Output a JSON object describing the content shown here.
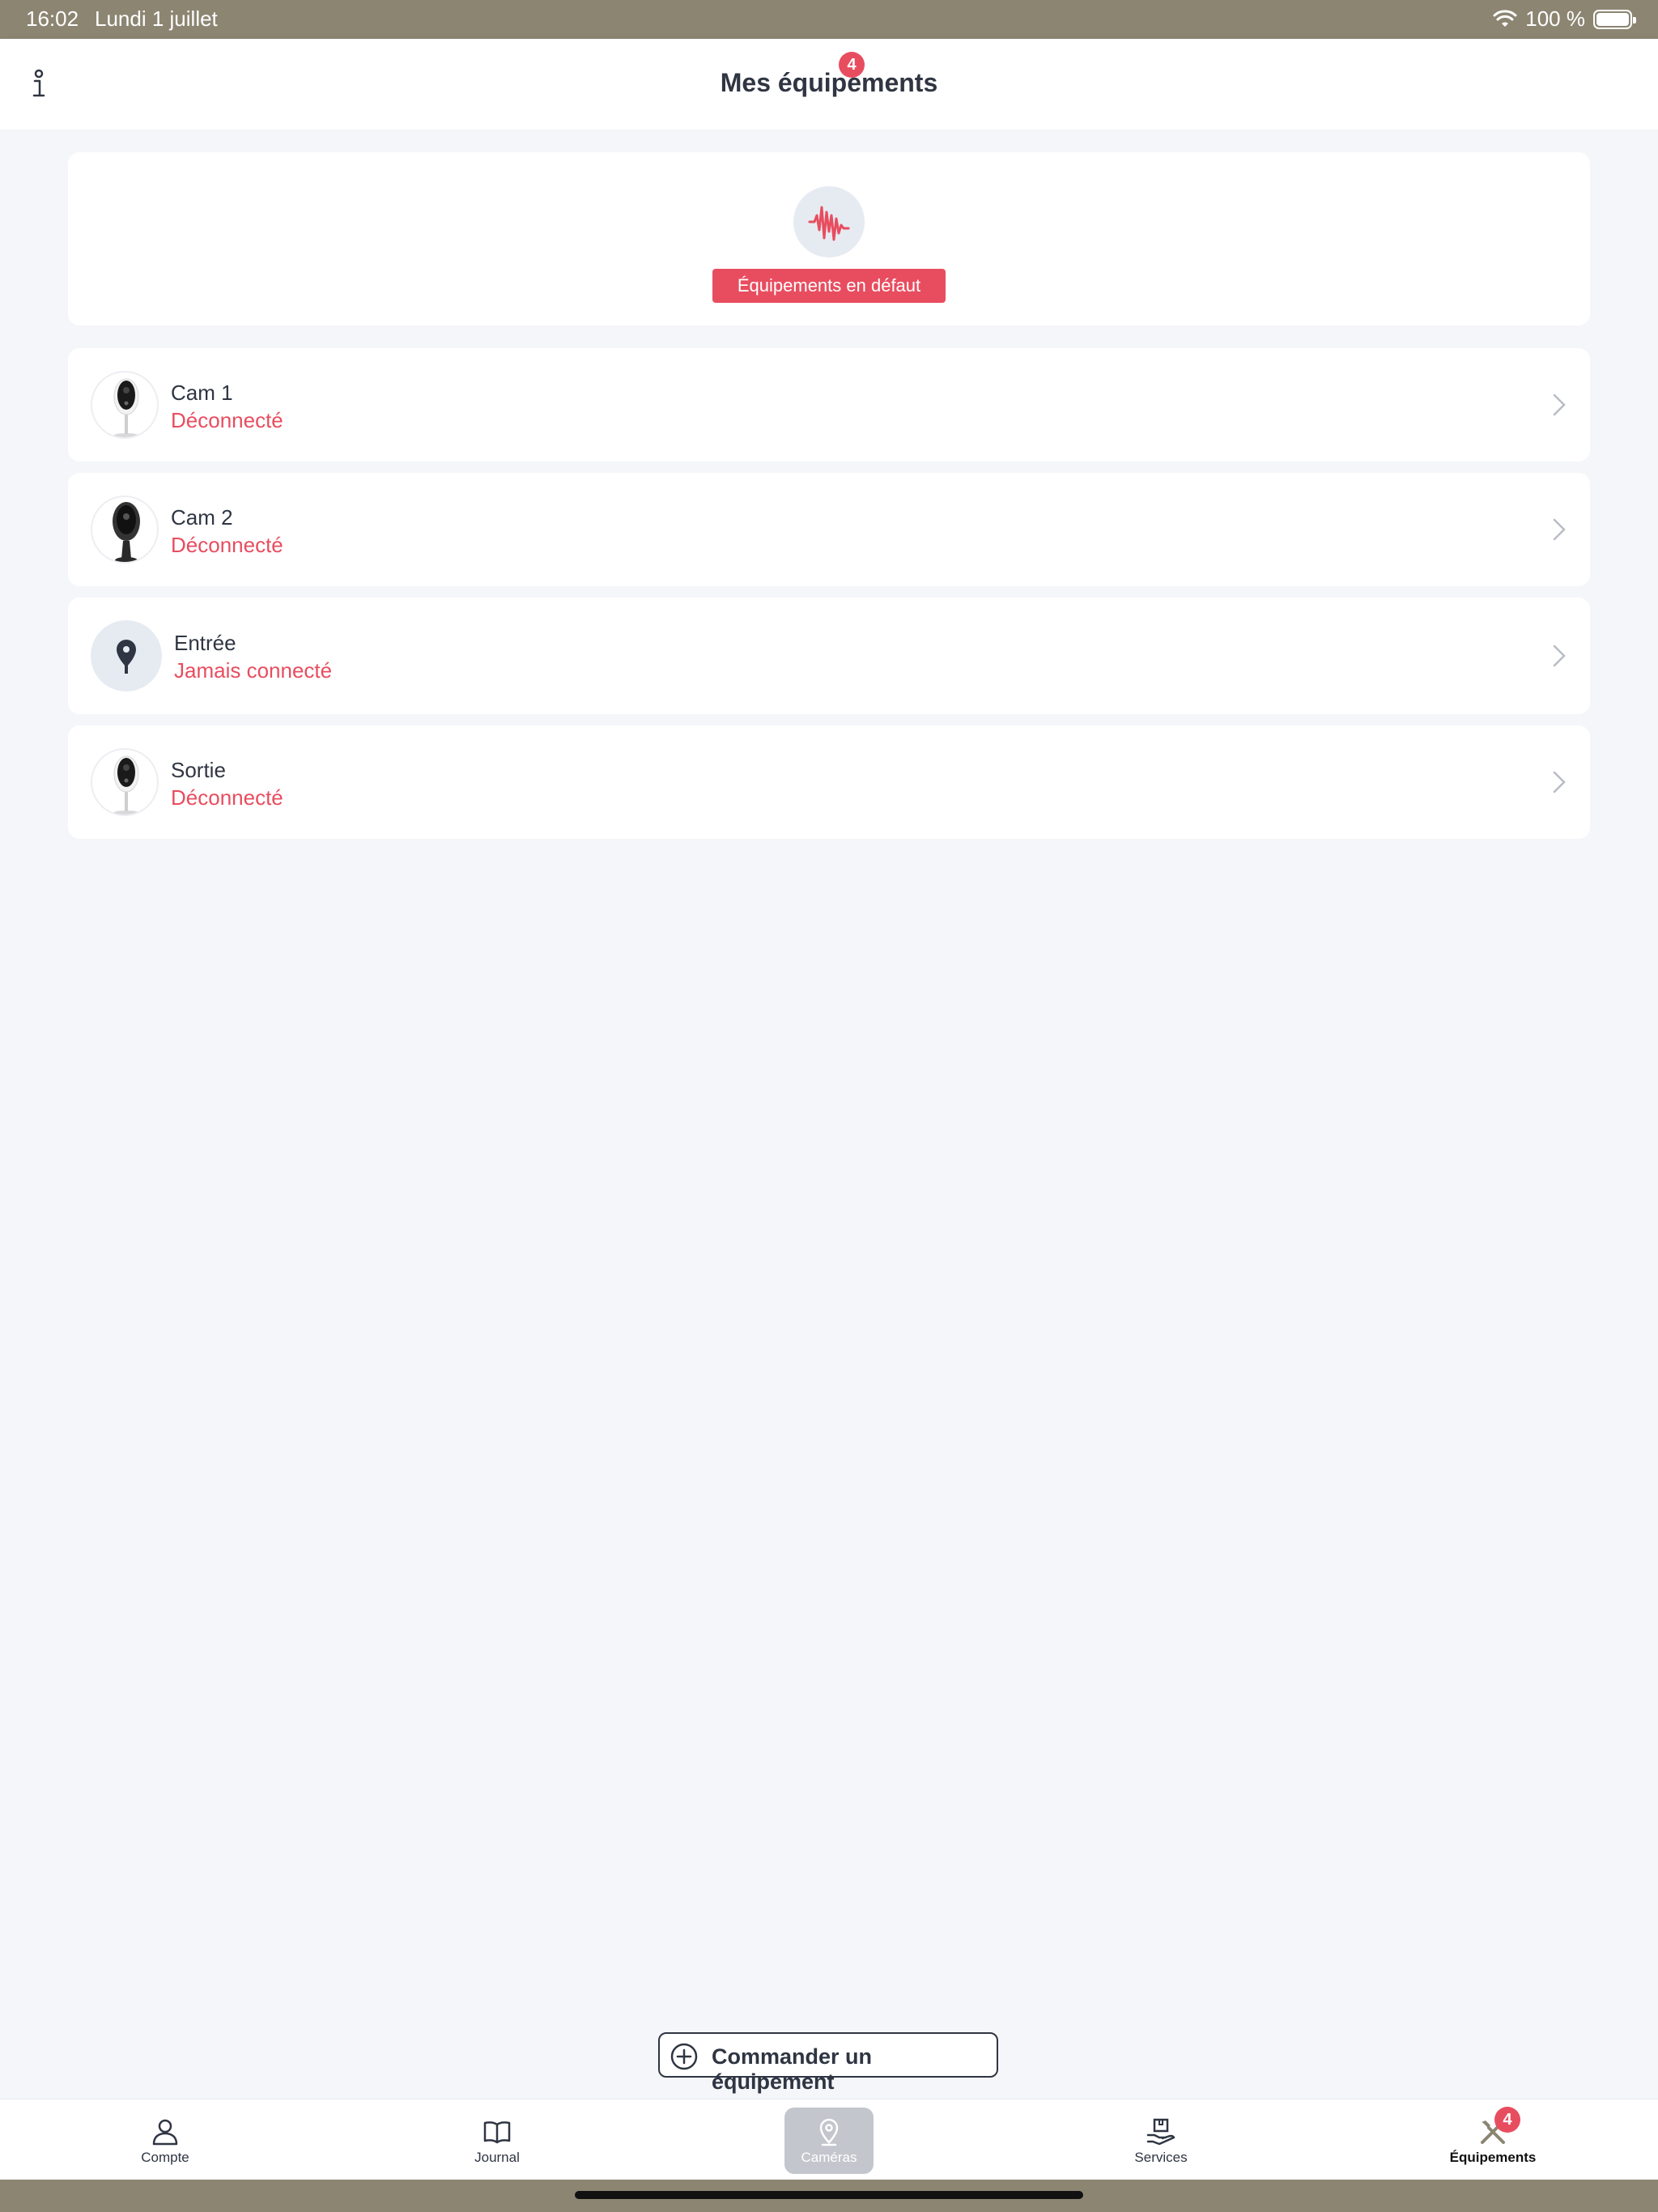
{
  "status_bar": {
    "time": "16:02",
    "date": "Lundi 1 juillet",
    "battery": "100 %"
  },
  "header": {
    "title": "Mes équipements"
  },
  "alert": {
    "count": "4",
    "label": "Équipements en défaut"
  },
  "devices": [
    {
      "name": "Cam 1",
      "status": "Déconnecté",
      "icon": "camera-white-icon"
    },
    {
      "name": "Cam 2",
      "status": "Déconnecté",
      "icon": "camera-black-icon"
    },
    {
      "name": "Entrée",
      "status": "Jamais connecté",
      "icon": "location-pin-icon"
    },
    {
      "name": "Sortie",
      "status": "Déconnecté",
      "icon": "camera-white-icon"
    }
  ],
  "order_button": {
    "label": "Commander un équipement"
  },
  "tabs": [
    {
      "label": "Compte",
      "icon": "user-icon"
    },
    {
      "label": "Journal",
      "icon": "book-icon"
    },
    {
      "label": "Caméras",
      "icon": "location-pin-icon"
    },
    {
      "label": "Services",
      "icon": "services-icon"
    },
    {
      "label": "Équipements",
      "icon": "tools-icon",
      "badge": "4"
    }
  ],
  "colors": {
    "accent": "#e84d5f",
    "background": "#f5f6fa",
    "status_bar": "#8c8572",
    "text": "#2f3542"
  }
}
